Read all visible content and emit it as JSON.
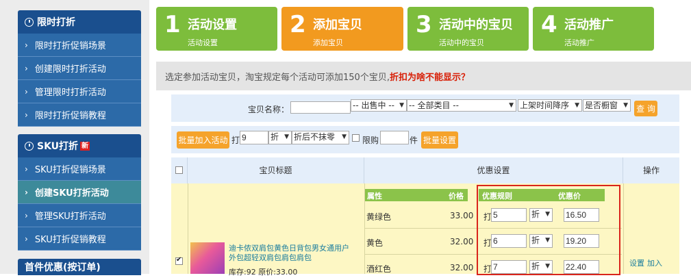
{
  "sidebar": {
    "sections": [
      {
        "title": "限时打折",
        "items": [
          "限时打折促销场景",
          "创建限时打折活动",
          "管理限时打折活动",
          "限时打折促销教程"
        ]
      },
      {
        "title": "SKU打折",
        "badge": "新",
        "items": [
          "SKU打折促销场景",
          "创建SKU打折活动",
          "管理SKU打折活动",
          "SKU打折促销教程"
        ],
        "active_index": 1
      },
      {
        "title": "首件优惠(按订单)"
      }
    ]
  },
  "steps": [
    {
      "num": "1",
      "title": "活动设置",
      "sub": "活动设置"
    },
    {
      "num": "2",
      "title": "添加宝贝",
      "sub": "添加宝贝"
    },
    {
      "num": "3",
      "title": "活动中的宝贝",
      "sub": "活动中的宝贝"
    },
    {
      "num": "4",
      "title": "活动推广",
      "sub": "活动推广"
    }
  ],
  "notice": {
    "text": "选定参加活动宝贝，淘宝规定每个活动可添加150个宝贝,",
    "link": "折扣为啥不能显示？"
  },
  "search": {
    "name_label": "宝贝名称：",
    "name_value": "",
    "status_select": "-- 出售中 --",
    "category_select": "-- 全部类目 --",
    "sort_select": "上架时间降序",
    "window_select": "是否橱窗",
    "query_button": "查 询"
  },
  "batch": {
    "add_button": "批量加入活动",
    "discount_prefix": "打",
    "discount_value": "9",
    "unit_select": "折",
    "rounding_select": "折后不抹零",
    "limit_label": "限购",
    "limit_value": "",
    "limit_unit": "件",
    "set_button": "批量设置"
  },
  "table": {
    "headers": {
      "title": "宝贝标题",
      "discount": "优惠设置",
      "ops": "操作"
    },
    "sub_headers": {
      "attr": "属性",
      "price": "价格",
      "rule": "优惠规则",
      "discount_price": "优惠价"
    },
    "product": {
      "title": "迪卡侬双肩包黄色日背包男女通用户外包超轻双肩包肩包肩包",
      "meta": "库存:92 原价:33.00",
      "ops_set": "设置",
      "ops_add": "加入"
    },
    "skus": [
      {
        "attr": "黄绿色",
        "price": "33.00",
        "prefix": "打",
        "rate": "5",
        "unit": "折",
        "discount_price": "16.50"
      },
      {
        "attr": "黄色",
        "price": "32.00",
        "prefix": "打",
        "rate": "6",
        "unit": "折",
        "discount_price": "19.20"
      },
      {
        "attr": "酒红色",
        "price": "32.00",
        "prefix": "打",
        "rate": "7",
        "unit": "折",
        "discount_price": "22.40"
      }
    ]
  },
  "colors": {
    "nav_blue": "#1a4f8e",
    "step_green": "#7dbd3c",
    "step_orange": "#f29a1f",
    "button_orange": "#f5a32b",
    "highlight_red": "#d9241b"
  }
}
